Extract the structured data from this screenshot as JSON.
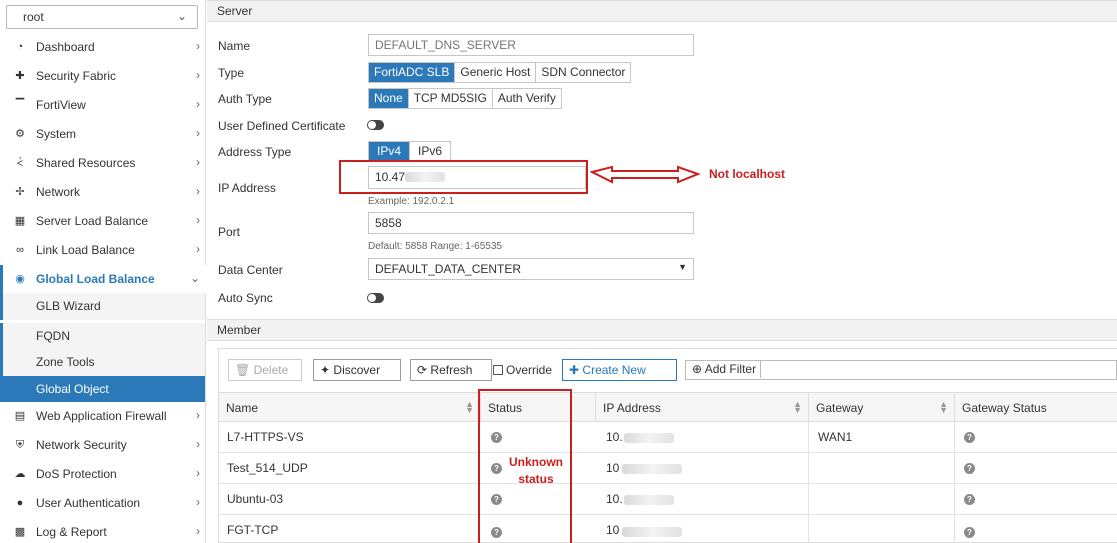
{
  "sidebar": {
    "vdom_value": "root",
    "items": [
      {
        "label": "Dashboard",
        "icon": "dashboard-icon"
      },
      {
        "label": "Security Fabric",
        "icon": "security-fabric-icon"
      },
      {
        "label": "FortiView",
        "icon": "fortiview-icon"
      },
      {
        "label": "System",
        "icon": "gear-icon"
      },
      {
        "label": "Shared Resources",
        "icon": "share-icon"
      },
      {
        "label": "Network",
        "icon": "network-icon"
      },
      {
        "label": "Server Load Balance",
        "icon": "server-load-balance-icon"
      },
      {
        "label": "Link Load Balance",
        "icon": "link-icon"
      },
      {
        "label": "Global Load Balance",
        "icon": "globe-icon"
      },
      {
        "label": "Web Application Firewall",
        "icon": "waf-icon"
      },
      {
        "label": "Network Security",
        "icon": "shield-icon"
      },
      {
        "label": "DoS Protection",
        "icon": "cloud-icon"
      },
      {
        "label": "User Authentication",
        "icon": "user-icon"
      },
      {
        "label": "Log & Report",
        "icon": "report-icon"
      }
    ],
    "subitems": [
      {
        "label": "GLB Wizard"
      },
      {
        "label": "FQDN"
      },
      {
        "label": "Zone Tools"
      },
      {
        "label": "Global Object"
      }
    ]
  },
  "server": {
    "section_title": "Server",
    "name_label": "Name",
    "name_placeholder": "DEFAULT_DNS_SERVER",
    "type_label": "Type",
    "type_options": [
      "FortiADC SLB",
      "Generic Host",
      "SDN Connector"
    ],
    "type_selected": "FortiADC SLB",
    "auth_label": "Auth Type",
    "auth_options": [
      "None",
      "TCP MD5SIG",
      "Auth Verify"
    ],
    "auth_selected": "None",
    "cert_label": "User Defined Certificate",
    "addr_type_label": "Address Type",
    "addr_options": [
      "IPv4",
      "IPv6"
    ],
    "addr_selected": "IPv4",
    "ip_label": "IP Address",
    "ip_value": "10.47.",
    "ip_hint": "Example: 192.0.2.1",
    "port_label": "Port",
    "port_value": "5858",
    "port_hint": "Default: 5858 Range: 1-65535",
    "dc_label": "Data Center",
    "dc_value": "DEFAULT_DATA_CENTER",
    "sync_label": "Auto Sync"
  },
  "member": {
    "section_title": "Member",
    "toolbar": {
      "delete": "Delete",
      "discover": "Discover",
      "refresh": "Refresh",
      "override": "Override",
      "create_new": "Create New",
      "add_filter": "Add Filter"
    },
    "columns": [
      "Name",
      "Status",
      "IP Address",
      "Gateway",
      "Gateway Status"
    ],
    "rows": [
      {
        "name": "L7-HTTPS-VS",
        "ip": "10.",
        "gateway": "WAN1"
      },
      {
        "name": "Test_514_UDP",
        "ip": "10",
        "gateway": ""
      },
      {
        "name": "Ubuntu-03",
        "ip": "10.",
        "gateway": ""
      },
      {
        "name": "FGT-TCP",
        "ip": "10",
        "gateway": ""
      }
    ]
  },
  "annotations": {
    "not_localhost": "Not localhost",
    "unknown_status_line1": "Unknown",
    "unknown_status_line2": "status"
  },
  "colors": {
    "accent": "#2b79b9",
    "annotation_red": "#c9201f"
  }
}
